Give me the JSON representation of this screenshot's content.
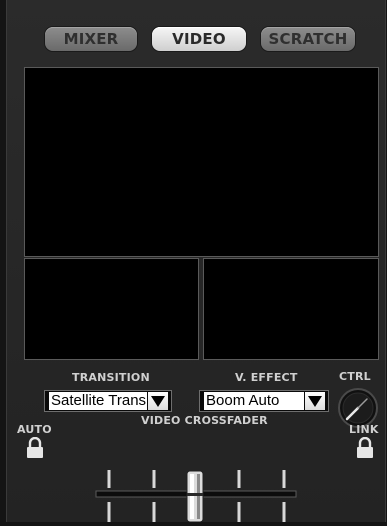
{
  "tabs": [
    {
      "label": "MIXER",
      "active": false
    },
    {
      "label": "VIDEO",
      "active": true
    },
    {
      "label": "SCRATCH",
      "active": false
    }
  ],
  "transition": {
    "label": "TRANSITION",
    "value": "Satellite Transition"
  },
  "video_effect": {
    "label": "V. EFFECT",
    "value": "Boom Auto"
  },
  "ctrl": {
    "label": "CTRL"
  },
  "auto": {
    "label": "AUTO",
    "icon": "lock-icon"
  },
  "link": {
    "label": "LINK",
    "icon": "lock-icon"
  },
  "crossfader": {
    "label": "VIDEO CROSSFADER",
    "position": 0.5
  },
  "colors": {
    "background": "#141414",
    "panel": "#272727",
    "active_tab": "#f0f0f0",
    "inactive_tab": "#7d7d7d",
    "screen": "#000000"
  }
}
